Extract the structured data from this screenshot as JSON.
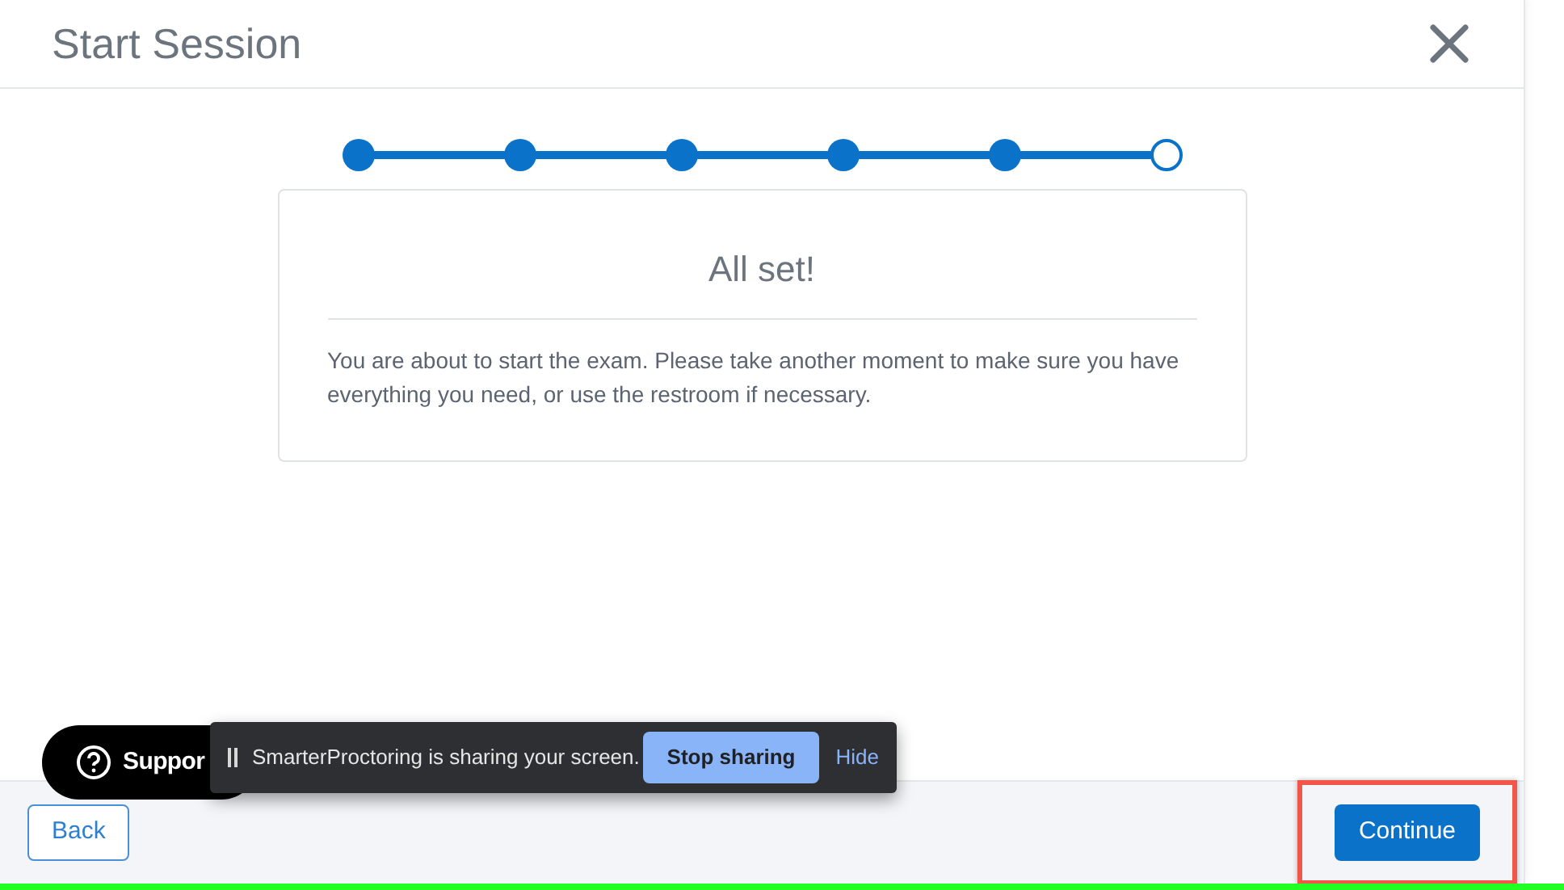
{
  "dialog": {
    "title": "Start Session"
  },
  "steps": [
    {
      "completed": true
    },
    {
      "completed": true
    },
    {
      "completed": true
    },
    {
      "completed": true
    },
    {
      "completed": true
    },
    {
      "completed": false
    }
  ],
  "card": {
    "heading": "All set!",
    "message": "You are about to start the exam. Please take another moment to make sure you have everything you need, or use the restroom if necessary."
  },
  "support": {
    "label": "Suppor"
  },
  "share_bar": {
    "message": "SmarterProctoring is sharing your screen.",
    "stop_button": "Stop sharing",
    "hide_link": "Hide"
  },
  "footer": {
    "back_button": "Back",
    "continue_button": "Continue",
    "continue_highlighted": true
  }
}
